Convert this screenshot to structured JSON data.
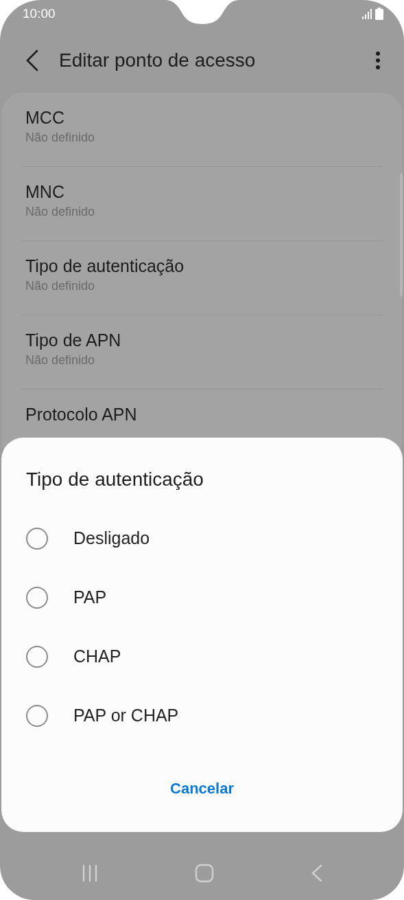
{
  "status_bar": {
    "time": "10:00"
  },
  "header": {
    "title": "Editar ponto de acesso"
  },
  "settings": [
    {
      "title": "MCC",
      "value": "Não definido"
    },
    {
      "title": "MNC",
      "value": "Não definido"
    },
    {
      "title": "Tipo de autenticação",
      "value": "Não definido"
    },
    {
      "title": "Tipo de APN",
      "value": "Não definido"
    },
    {
      "title": "Protocolo APN"
    }
  ],
  "dialog": {
    "title": "Tipo de autenticação",
    "options": [
      {
        "label": "Desligado",
        "selected": false
      },
      {
        "label": "PAP",
        "selected": false
      },
      {
        "label": "CHAP",
        "selected": false
      },
      {
        "label": "PAP or CHAP",
        "selected": false
      }
    ],
    "button": "Cancelar"
  }
}
